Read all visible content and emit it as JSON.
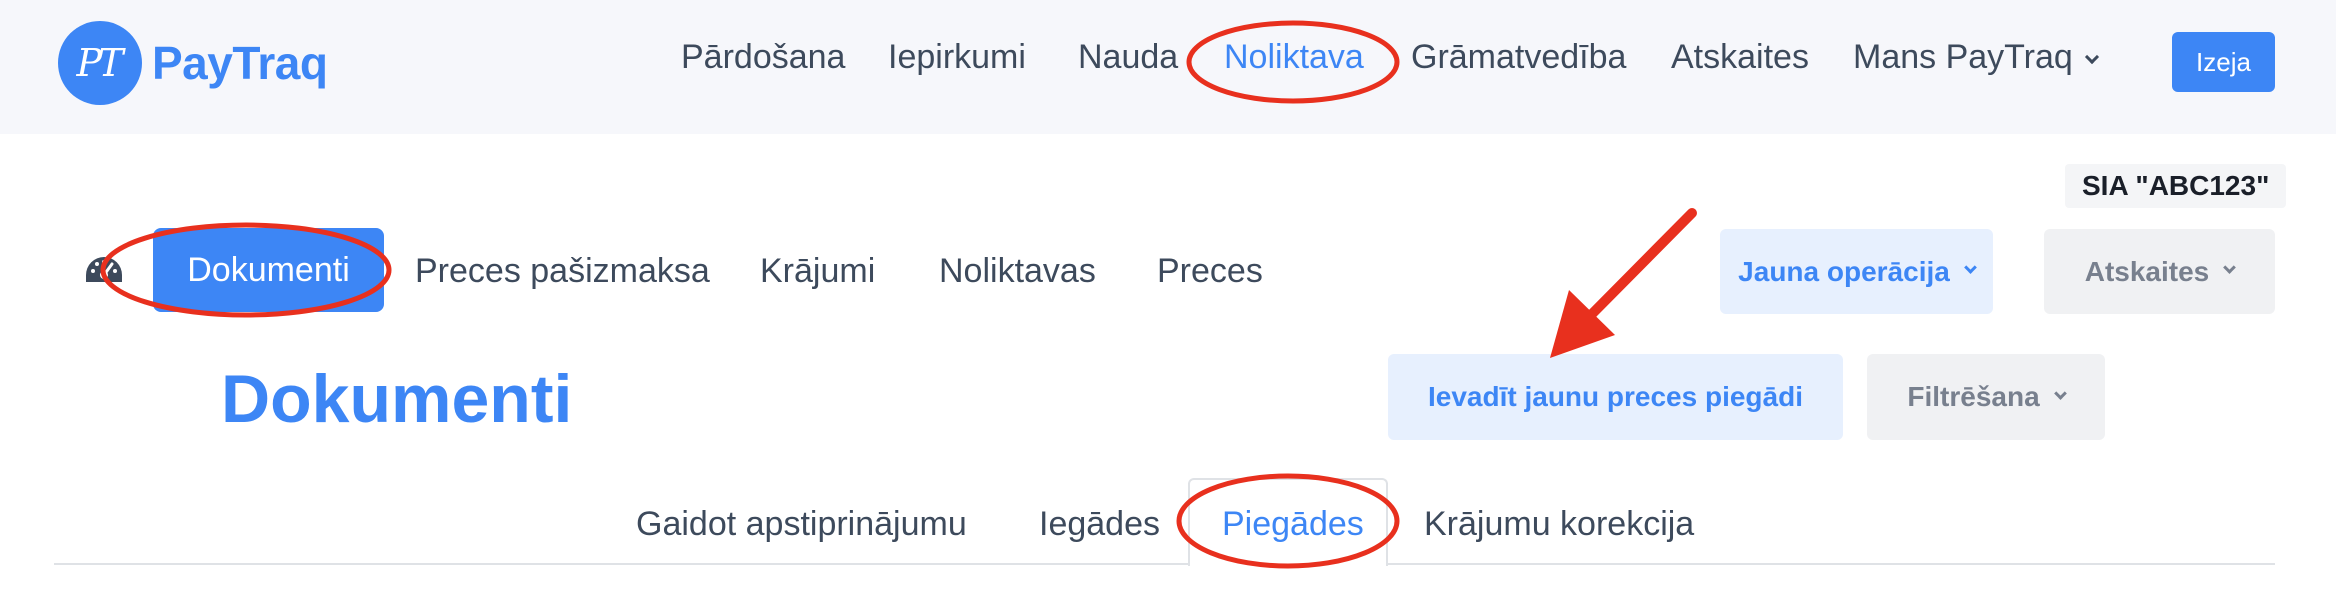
{
  "brand": {
    "name": "PayTraq",
    "monogram": "PT"
  },
  "topnav": {
    "items": [
      {
        "label": "Pārdošana"
      },
      {
        "label": "Iepirkumi"
      },
      {
        "label": "Nauda"
      },
      {
        "label": "Noliktava",
        "active": true
      },
      {
        "label": "Grāmatvedība"
      },
      {
        "label": "Atskaites"
      },
      {
        "label": "Mans PayTraq",
        "dropdown": true
      }
    ],
    "exit_label": "Izeja"
  },
  "company": "SIA \"ABC123\"",
  "subnav": {
    "items": [
      {
        "label": "Dokumenti",
        "active": true
      },
      {
        "label": "Preces pašizmaksa"
      },
      {
        "label": "Krājumi"
      },
      {
        "label": "Noliktavas"
      },
      {
        "label": "Preces"
      }
    ],
    "new_operation_label": "Jauna operācija",
    "reports_label": "Atskaites"
  },
  "page": {
    "title": "Dokumenti",
    "new_delivery_label": "Ievadīt jaunu preces piegādi",
    "filter_label": "Filtrēšana"
  },
  "tabs": [
    {
      "label": "Gaidot apstiprinājumu"
    },
    {
      "label": "Iegādes"
    },
    {
      "label": "Piegādes",
      "active": true
    },
    {
      "label": "Krājumu korekcija"
    }
  ],
  "colors": {
    "accent": "#3d86f5",
    "annotation": "#e8301e",
    "text": "#3d4a5c",
    "header_bg": "#f6f7fb"
  }
}
